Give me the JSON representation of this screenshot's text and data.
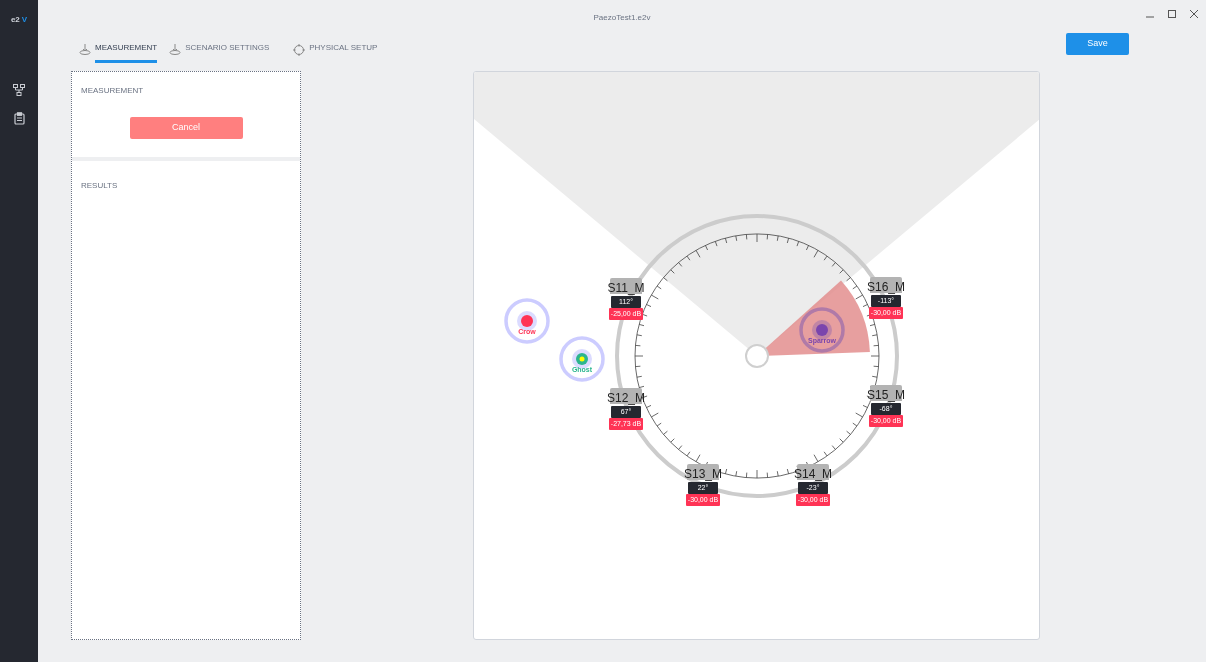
{
  "app": {
    "logo_prefix": "e2",
    "logo_mark": "V"
  },
  "window": {
    "title": "PaezoTest1.e2v"
  },
  "tabs": [
    {
      "label": "MEASUREMENT",
      "selected": true
    },
    {
      "label": "SCENARIO SETTINGS",
      "selected": false
    },
    {
      "label": "PHYSICAL SETUP",
      "selected": false
    }
  ],
  "save_button": "Save",
  "measurement_panel": {
    "title": "MEASUREMENT",
    "cancel_button": "Cancel"
  },
  "results_panel": {
    "title": "RESULTS"
  },
  "sensors": [
    {
      "name": "S11_M",
      "angle": "112°",
      "gain": "-25,00 dB"
    },
    {
      "name": "S16_M",
      "angle": "-113°",
      "gain": "-30,00 dB"
    },
    {
      "name": "S12_M",
      "angle": "67°",
      "gain": "-27,73 dB"
    },
    {
      "name": "S15_M",
      "angle": "-68°",
      "gain": "-30,00 dB"
    },
    {
      "name": "S13_M",
      "angle": "22°",
      "gain": "-30,00 dB"
    },
    {
      "name": "S14_M",
      "angle": "-23°",
      "gain": "-30,00 dB"
    }
  ],
  "targets": [
    {
      "name": "Crow",
      "color": "#ff3355",
      "beam_sector": false
    },
    {
      "name": "Ghost",
      "color": "#2bb58f",
      "beam_sector": false
    },
    {
      "name": "Sparrow",
      "color": "#7a45ad",
      "beam_sector": true
    }
  ]
}
